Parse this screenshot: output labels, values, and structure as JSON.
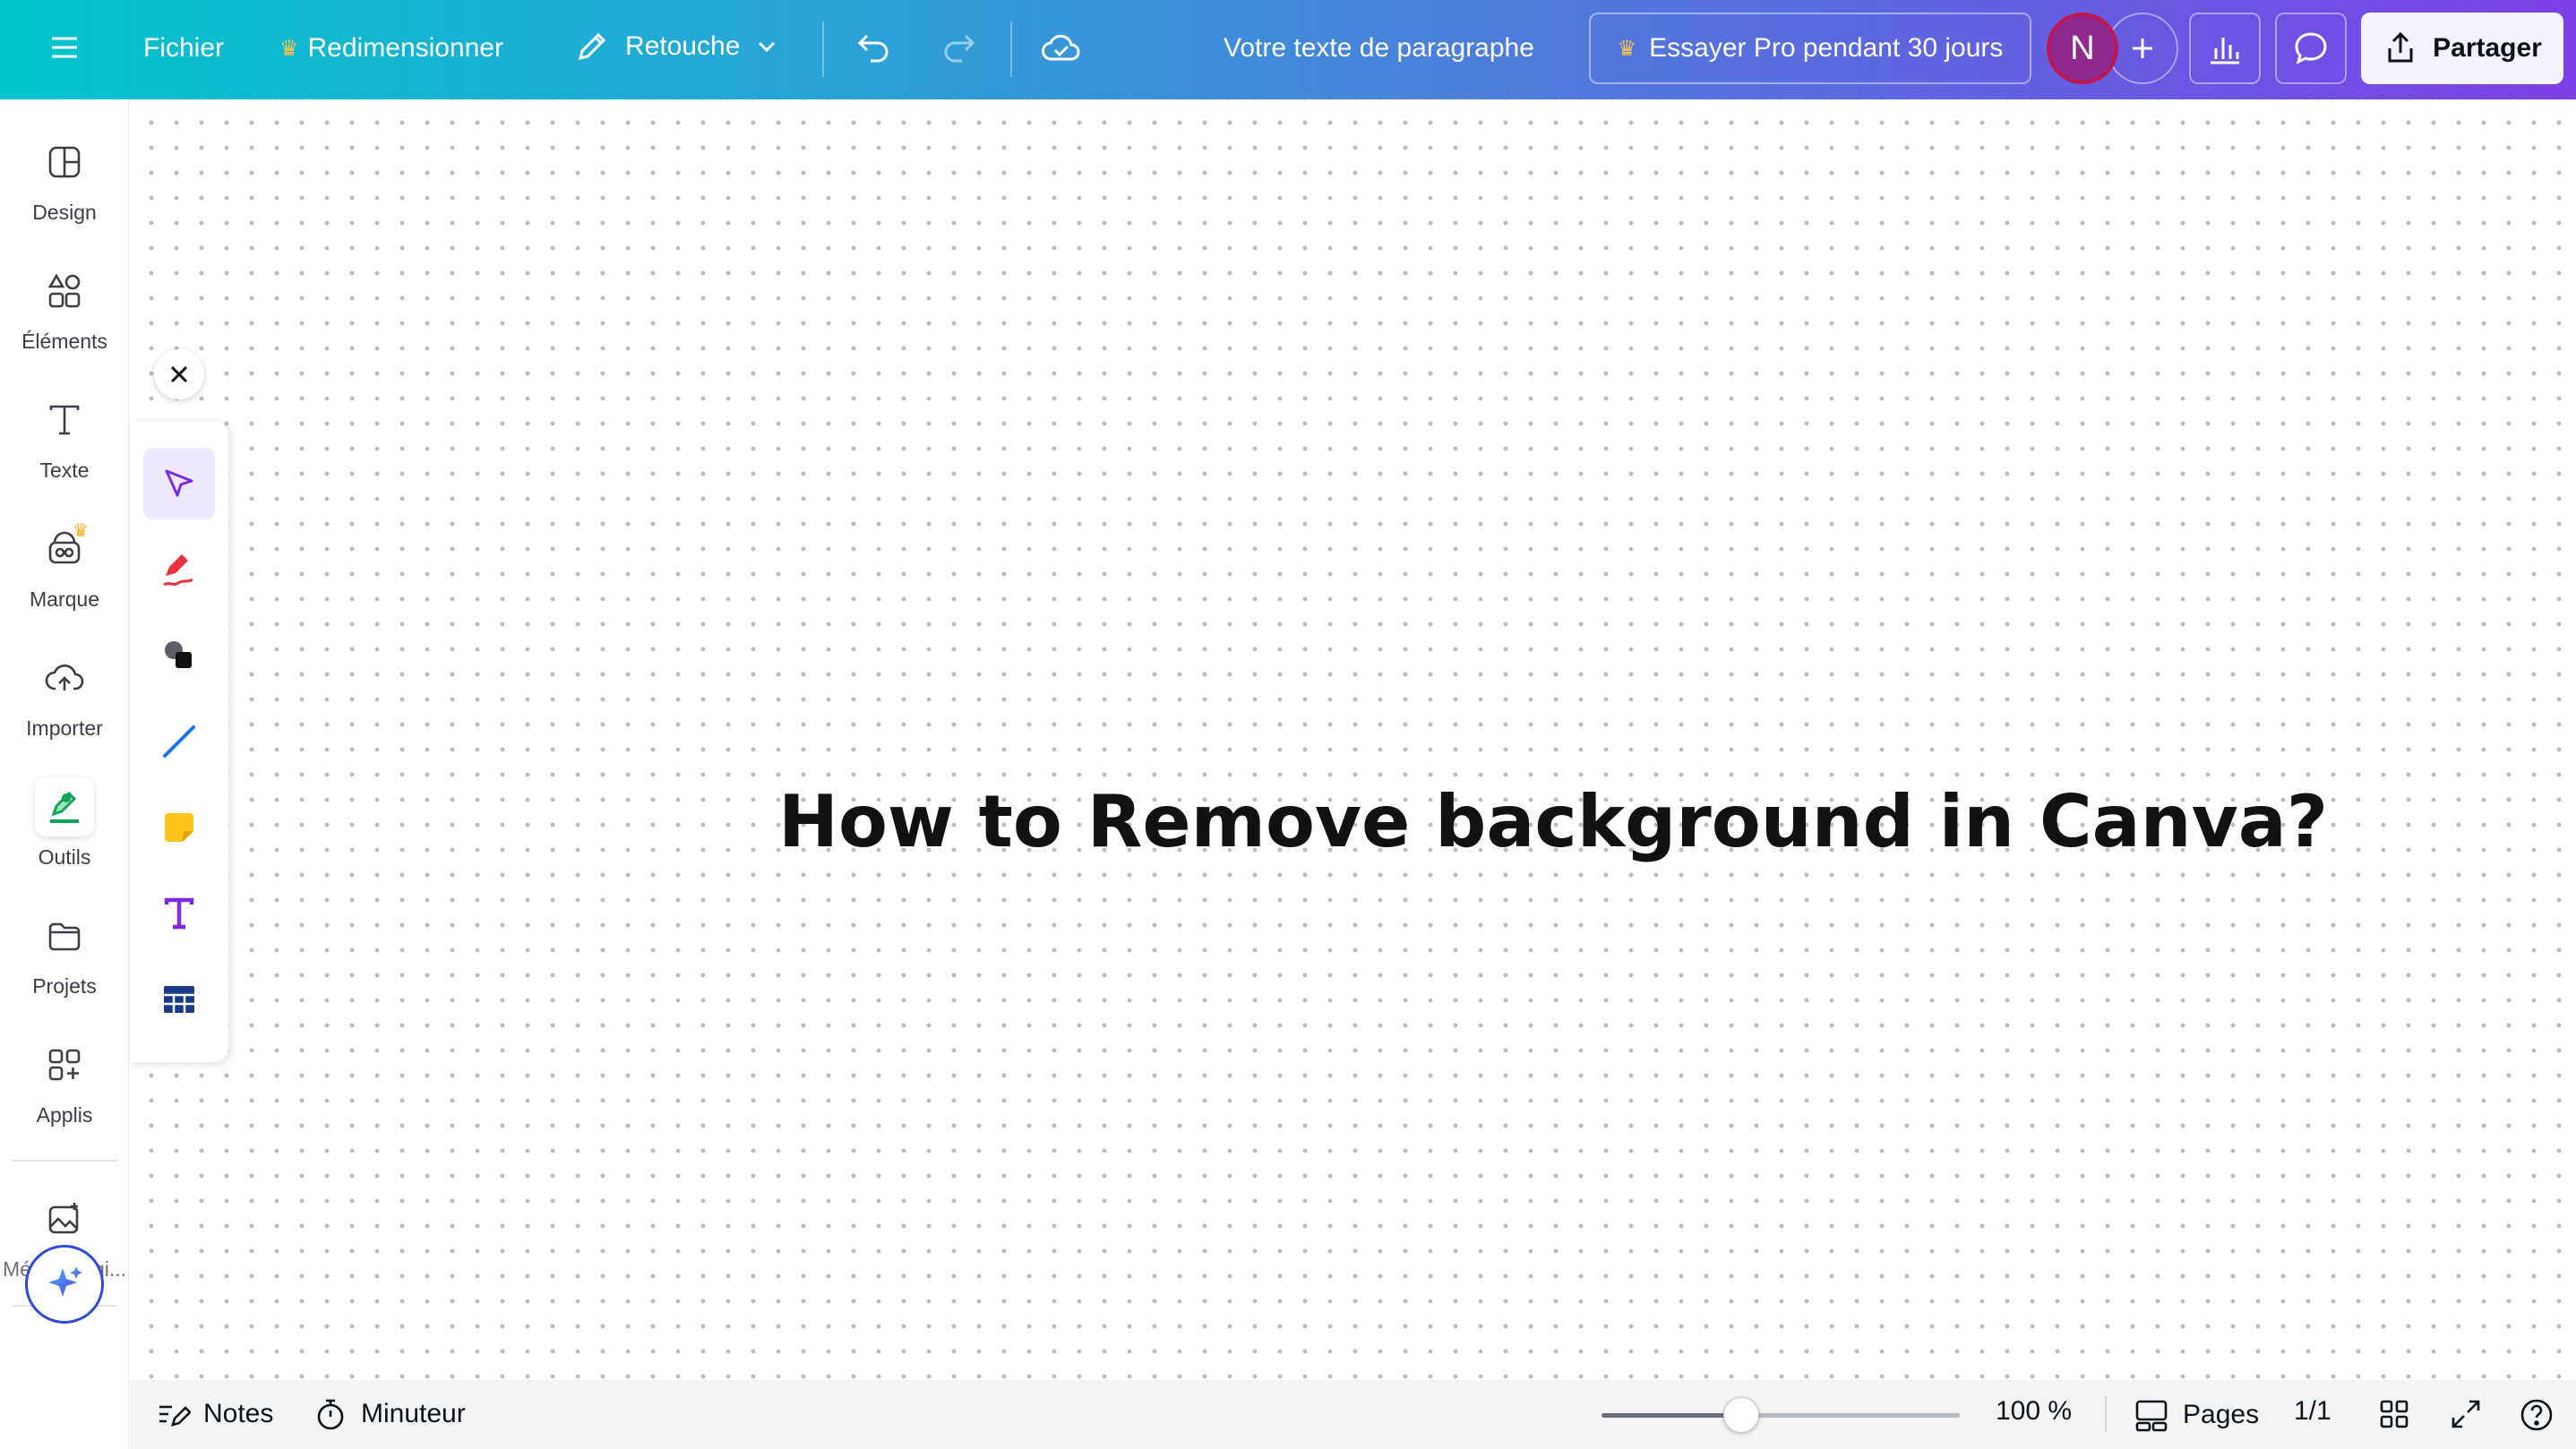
{
  "topbar": {
    "file_label": "Fichier",
    "resize_label": "Redimensionner",
    "edit_label": "Retouche",
    "doc_title": "Votre texte de paragraphe",
    "pro_label": "Essayer Pro pendant 30 jours",
    "avatar_initial": "N",
    "share_label": "Partager"
  },
  "sidebar": {
    "items": [
      {
        "label": "Design",
        "icon": "design-icon"
      },
      {
        "label": "Éléments",
        "icon": "elements-icon"
      },
      {
        "label": "Texte",
        "icon": "text-icon"
      },
      {
        "label": "Marque",
        "icon": "brand-icon"
      },
      {
        "label": "Importer",
        "icon": "upload-icon"
      },
      {
        "label": "Outils",
        "icon": "tools-icon"
      },
      {
        "label": "Projets",
        "icon": "folder-icon"
      },
      {
        "label": "Applis",
        "icon": "apps-icon"
      },
      {
        "label": "Média magi...",
        "icon": "magic-media-icon"
      }
    ],
    "active_item": "Outils"
  },
  "canvas": {
    "headline": "How to Remove background in Canva?"
  },
  "palette": {
    "tools": [
      "select-icon",
      "pen-icon",
      "shapes-icon",
      "line-icon",
      "sticky-note-icon",
      "text-tool-icon",
      "table-icon"
    ],
    "active_tool": "select-icon"
  },
  "bottombar": {
    "notes_label": "Notes",
    "timer_label": "Minuteur",
    "zoom_fraction": 0.39,
    "zoom_label": "100 %",
    "pages_label": "Pages",
    "page_count": "1/1"
  },
  "colors": {
    "gradient_start": "#00c4cc",
    "gradient_end": "#7b40e6",
    "accent_purple": "#8b3dff",
    "pen_red": "#e8333f",
    "line_blue": "#1a73e8",
    "sticky_yellow": "#fcc419",
    "text_purple": "#7d2ae8",
    "table_navy": "#1e3a8a"
  }
}
